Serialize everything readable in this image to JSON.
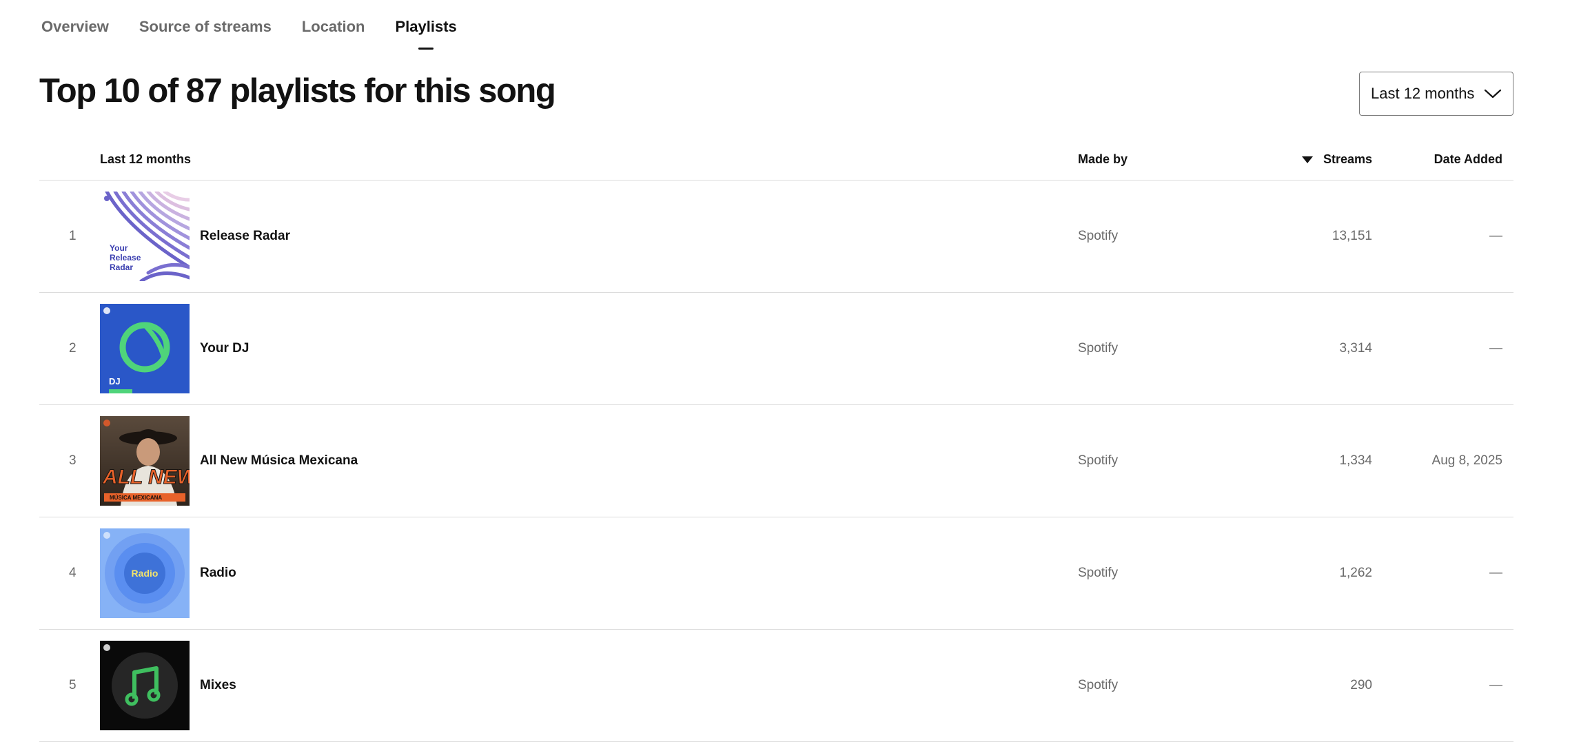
{
  "tabs": [
    {
      "label": "Overview"
    },
    {
      "label": "Source of streams"
    },
    {
      "label": "Location"
    },
    {
      "label": "Playlists"
    }
  ],
  "heading": "Top 10 of 87 playlists for this song",
  "range_select": {
    "value": "Last 12 months"
  },
  "table": {
    "headers": {
      "period": "Last 12 months",
      "made_by": "Made by",
      "streams": "Streams",
      "date_added": "Date Added"
    },
    "sort": {
      "column": "streams",
      "direction": "descending"
    },
    "rows": [
      {
        "rank": "1",
        "name": "Release Radar",
        "made_by": "Spotify",
        "streams": "13,151",
        "date_added": "—",
        "cover": {
          "icon": "release-radar-cover",
          "text_lines": [
            "Your",
            "Release",
            "Radar"
          ]
        }
      },
      {
        "rank": "2",
        "name": "Your DJ",
        "made_by": "Spotify",
        "streams": "3,314",
        "date_added": "—",
        "cover": {
          "icon": "dj-cover",
          "text": "DJ"
        }
      },
      {
        "rank": "3",
        "name": "All New Música Mexicana",
        "made_by": "Spotify",
        "streams": "1,334",
        "date_added": "Aug 8, 2025",
        "cover": {
          "icon": "all-new-musica-mexicana-cover",
          "text_big": "ALL NEW",
          "text_small": "MÚSICA MEXICANA"
        }
      },
      {
        "rank": "4",
        "name": "Radio",
        "made_by": "Spotify",
        "streams": "1,262",
        "date_added": "—",
        "cover": {
          "icon": "radio-cover",
          "text": "Radio"
        }
      },
      {
        "rank": "5",
        "name": "Mixes",
        "made_by": "Spotify",
        "streams": "290",
        "date_added": "—",
        "cover": {
          "icon": "mixes-music-note-cover"
        }
      }
    ]
  },
  "colors": {
    "text": "#121212",
    "muted": "#6a6a6a",
    "divider": "#dcdcdc",
    "dj_blue": "#2a57c8",
    "dj_green": "#4fd47a",
    "radio_blue": "#5a8ef0",
    "mixes_green": "#3fbf5f",
    "radar_purple": "#6b63c9"
  }
}
